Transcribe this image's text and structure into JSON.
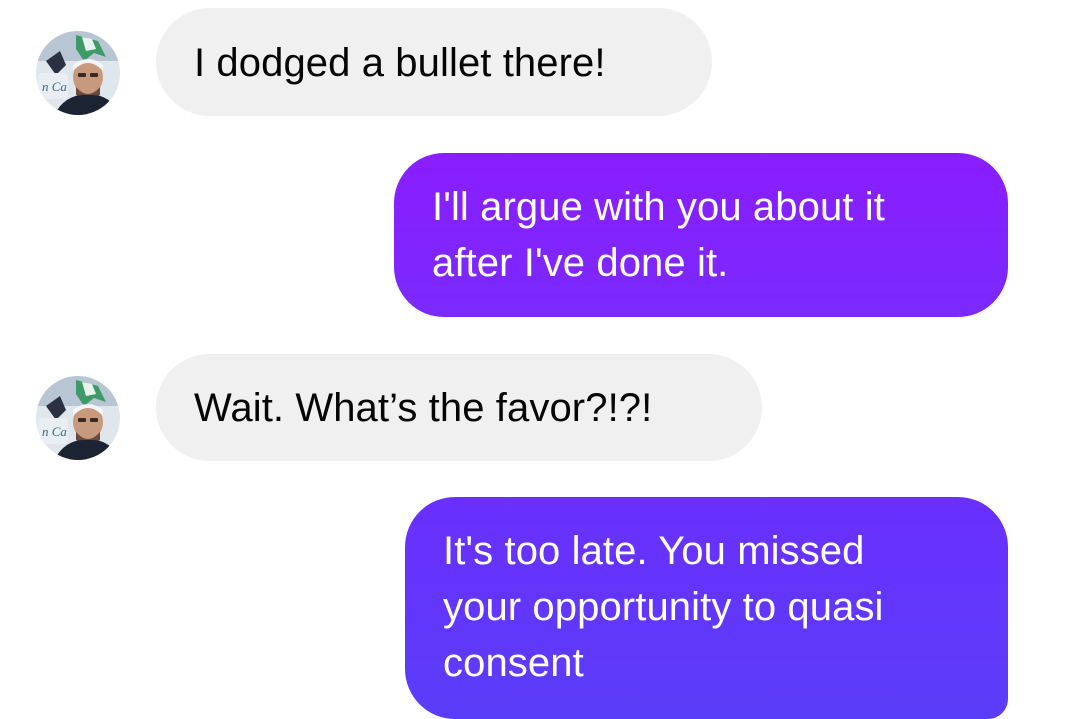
{
  "conversation": {
    "messages": [
      {
        "direction": "incoming",
        "text": "I dodged a bullet there!",
        "show_avatar": true
      },
      {
        "direction": "outgoing",
        "text": "I'll argue with you about it\nafter I've done it."
      },
      {
        "direction": "incoming",
        "text": "Wait. What’s the favor?!?!",
        "show_avatar": true
      },
      {
        "direction": "outgoing",
        "text": "It's too late.  You missed\nyour opportunity to quasi\nconsent"
      }
    ]
  },
  "colors": {
    "incoming_bubble": "#f0f0f0",
    "outgoing_bubble_top": "#8a1dff",
    "outgoing_bubble_bottom": "#5a3df9",
    "incoming_text": "#050505",
    "outgoing_text": "#ffffff"
  }
}
